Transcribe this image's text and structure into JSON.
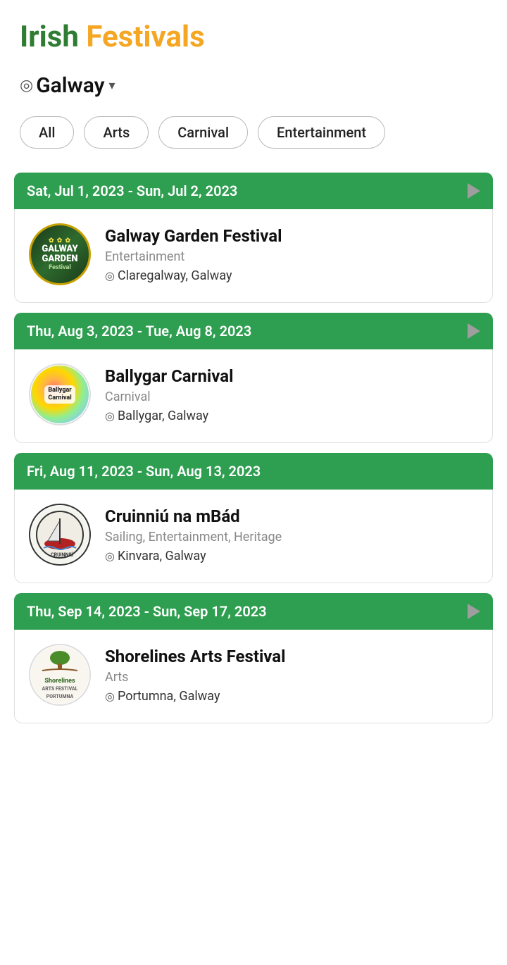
{
  "app": {
    "title_irish": "Irish",
    "title_festivals": " Festivals"
  },
  "location": {
    "name": "Galway",
    "icon": "📍"
  },
  "filters": [
    {
      "label": "All",
      "active": false
    },
    {
      "label": "Arts",
      "active": false
    },
    {
      "label": "Carnival",
      "active": false
    },
    {
      "label": "Entertainment",
      "active": false
    }
  ],
  "festivals": [
    {
      "date_range": "Sat, Jul 1, 2023 - Sun, Jul 2, 2023",
      "has_active_play": false,
      "name": "Galway Garden Festival",
      "category": "Entertainment",
      "location": "Claregalway, Galway",
      "logo_type": "galway-garden",
      "logo_line1": "✿",
      "logo_line2": "Galway\nGarden",
      "logo_line3": "Festival"
    },
    {
      "date_range": "Thu, Aug 3, 2023 - Tue, Aug 8, 2023",
      "has_active_play": false,
      "name": "Ballygar Carnival",
      "category": "Carnival",
      "location": "Ballygar, Galway",
      "logo_type": "ballygar",
      "logo_text": "Ballygar\nCarnival"
    },
    {
      "date_range": "Fri, Aug 11, 2023 - Sun, Aug 13, 2023",
      "has_active_play": true,
      "name": "Cruinniú na mBád",
      "category": "Sailing, Entertainment, Heritage",
      "location": "Kinvara, Galway",
      "logo_type": "cruinniu"
    },
    {
      "date_range": "Thu, Sep 14, 2023 - Sun, Sep 17, 2023",
      "has_active_play": false,
      "name": "Shorelines Arts Festival",
      "category": "Arts",
      "location": "Portumna, Galway",
      "logo_type": "shorelines",
      "logo_text": "Shorelines\nARTS FESTIVAL\nPORTUMNA"
    }
  ]
}
